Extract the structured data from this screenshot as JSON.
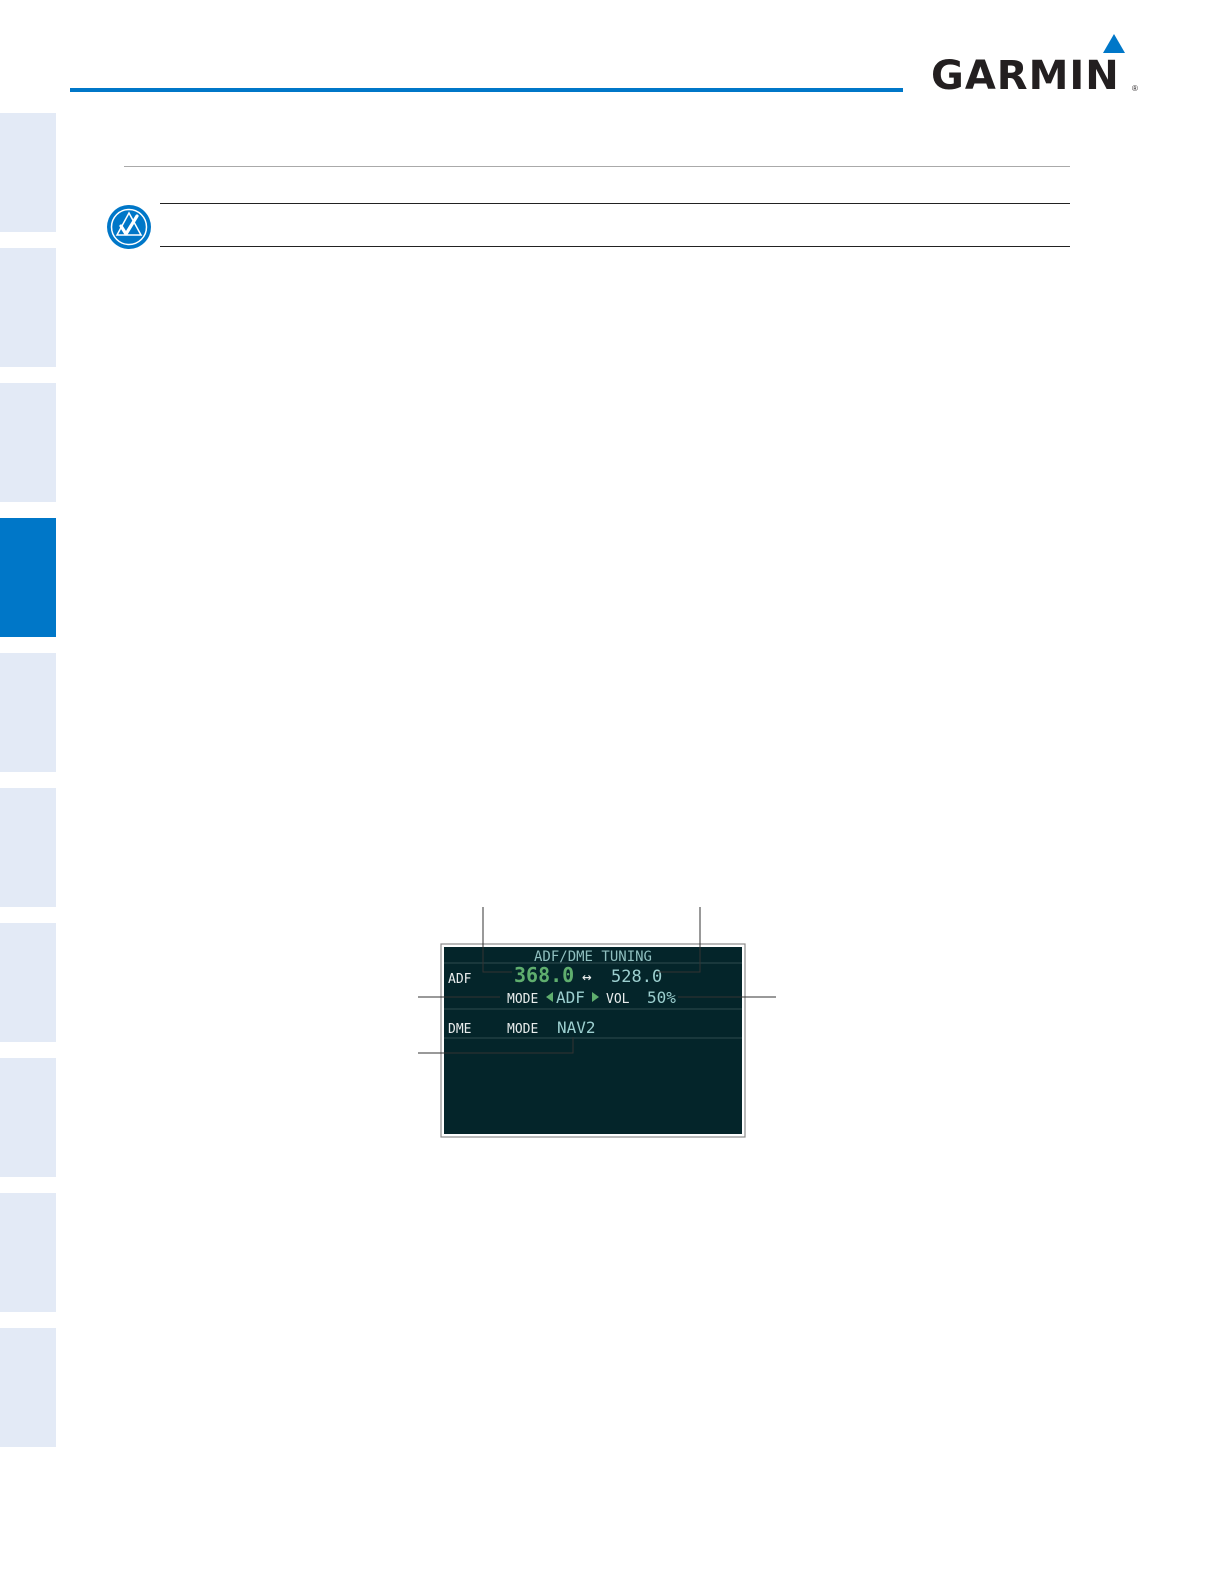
{
  "brand": {
    "logo_text": "GARMIN",
    "accent_color": "#0077c8",
    "tab_color_inactive": "#e3eaf6",
    "tab_color_active": "#0077c8"
  },
  "side_tabs": [
    {
      "active": false
    },
    {
      "active": false
    },
    {
      "active": false
    },
    {
      "active": true
    },
    {
      "active": false
    },
    {
      "active": false
    },
    {
      "active": false
    },
    {
      "active": false
    },
    {
      "active": false
    },
    {
      "active": false
    }
  ],
  "note": {
    "icon": "note-checkmark-icon"
  },
  "window": {
    "title": "ADF/DME TUNING",
    "adf_label": "ADF",
    "active_freq": "368.0",
    "swap_symbol": "↔",
    "standby_freq": "528.0",
    "mode_label": "MODE",
    "adf_mode": "ADF",
    "vol_label": "VOL",
    "volume": "50%",
    "dme_label": "DME",
    "dme_mode_label": "MODE",
    "dme_mode": "NAV2",
    "colors": {
      "background": "#04252a",
      "label": "#e8ecec",
      "title": "#8fbfbf",
      "active": "#5fae6e",
      "standby": "#9ccfcf",
      "divider": "#2e4b4e"
    }
  }
}
